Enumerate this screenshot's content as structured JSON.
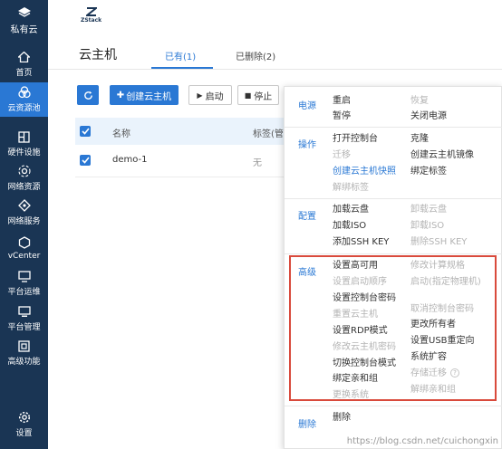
{
  "sidebar": {
    "top": {
      "label": "私有云",
      "icon": "layers-icon"
    },
    "items": [
      {
        "label": "首页",
        "icon": "home-icon"
      },
      {
        "label": "云资源池",
        "icon": "cloud-pool-icon"
      },
      {
        "label": "硬件设施",
        "icon": "hardware-icon"
      },
      {
        "label": "网络资源",
        "icon": "network-icon"
      },
      {
        "label": "网络服务",
        "icon": "network-service-icon"
      },
      {
        "label": "vCenter",
        "icon": "vcenter-icon"
      },
      {
        "label": "平台运维",
        "icon": "ops-icon"
      },
      {
        "label": "平台管理",
        "icon": "platform-icon"
      },
      {
        "label": "高级功能",
        "icon": "advanced-icon"
      },
      {
        "label": "设置",
        "icon": "gear-icon"
      }
    ],
    "active_index": 1,
    "colors": {
      "bg": "#1a3554",
      "active": "#2a78d4"
    }
  },
  "header": {
    "logo_text": "ZStack"
  },
  "page": {
    "title": "云主机",
    "tabs": [
      {
        "label": "已有(1)",
        "active": true
      },
      {
        "label": "已删除(2)",
        "active": false
      }
    ]
  },
  "toolbar": {
    "refresh_icon": "refresh-icon",
    "create_label": "创建云主机",
    "start_label": "启动",
    "stop_label": "停止"
  },
  "table": {
    "columns": [
      "名称",
      "标签(管"
    ],
    "rows": [
      {
        "name": "demo-1",
        "tag": "无",
        "checked": true
      }
    ],
    "header_checked": true
  },
  "menu": {
    "sections": {
      "power": "电源",
      "ops": "操作",
      "config": "配置",
      "advanced": "高级",
      "delete": "删除"
    },
    "power": {
      "reboot": "重启",
      "recover": "恢复",
      "pause": "暂停",
      "poweroff": "关闭电源"
    },
    "ops": {
      "console": "打开控制台",
      "clone": "克隆",
      "migrate": "迁移",
      "create_image": "创建云主机镜像",
      "create_snapshot": "创建云主机快照",
      "bind_tag": "绑定标签",
      "unbind_tag": "解绑标签"
    },
    "config": {
      "attach_volume": "加载云盘",
      "detach_volume": "卸载云盘",
      "attach_iso": "加载ISO",
      "detach_iso": "卸载ISO",
      "add_ssh": "添加SSH KEY",
      "delete_ssh": "删除SSH KEY"
    },
    "advanced": {
      "set_ha": "设置高可用",
      "change_spec": "修改计算规格",
      "boot_order": "设置启动顺序",
      "start_on_host": "启动(指定物理机)",
      "console_pwd": "设置控制台密码",
      "cancel_console_pwd": "取消控制台密码",
      "reset_vm": "重置云主机",
      "change_owner": "更改所有者",
      "rdp_mode": "设置RDP模式",
      "usb_redirect": "设置USB重定向",
      "change_vm_pwd": "修改云主机密码",
      "expand_system": "系统扩容",
      "switch_console": "切换控制台模式",
      "storage_migrate": "存储迁移",
      "bind_affinity": "绑定亲和组",
      "unbind_affinity": "解绑亲和组",
      "change_os": "更换系统"
    },
    "delete": {
      "delete": "删除"
    },
    "highlight_color": "#d94a3c"
  },
  "watermark": "https://blog.csdn.net/cuichongxin"
}
